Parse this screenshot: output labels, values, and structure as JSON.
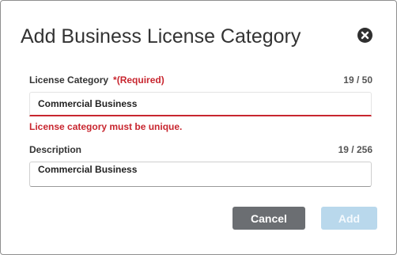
{
  "dialog": {
    "title": "Add Business License Category",
    "close_icon": "close-circle-icon"
  },
  "license_category": {
    "label": "License Category",
    "required_text": "*(Required)",
    "counter": "19 / 50",
    "value": "Commercial Business",
    "error": "License category must be unique."
  },
  "description": {
    "label": "Description",
    "counter": "19 / 256",
    "value": "Commercial Business"
  },
  "buttons": {
    "cancel": "Cancel",
    "add": "Add"
  },
  "colors": {
    "error": "#c8262f",
    "cancel_bg": "#6b6e72",
    "add_bg_disabled": "#b9d8ec"
  }
}
